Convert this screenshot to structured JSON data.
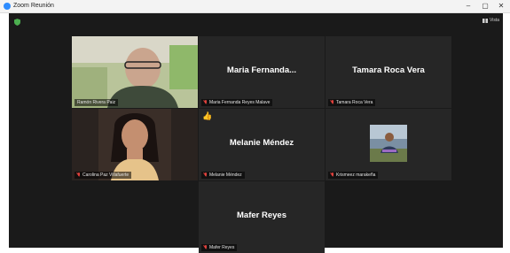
{
  "window": {
    "title": "Zoom Reunión",
    "controls": {
      "minimize": "–",
      "maximize": "▢",
      "close": "✕"
    }
  },
  "toolbar": {
    "view_label": "Vista"
  },
  "participants": [
    {
      "name": "Ramón Rivera Paiz",
      "label": "Ramón Rivera Paiz",
      "video": true,
      "active_speaker": true,
      "muted": false
    },
    {
      "name": "Maria  Fernanda...",
      "label": "Maria Fernanda Reyes Malave",
      "video": false,
      "muted": true
    },
    {
      "name": "Tamara Roca Vera",
      "label": "Tamara Roca Vera",
      "video": false,
      "muted": true
    },
    {
      "name": "Carolina Paz Villafuerte",
      "label": "Carolina Paz Villafuerte",
      "video": true,
      "muted": true
    },
    {
      "name": "Melanie Méndez",
      "label": "Melanie Méndez",
      "video": false,
      "muted": true,
      "reaction": "👍"
    },
    {
      "name": "Krismeez marakeña",
      "label": "Krismeez marakeña",
      "video": true,
      "muted": true
    },
    {
      "name": "Mafer Reyes",
      "label": "Mafer Reyes",
      "video": false,
      "muted": true
    }
  ],
  "colors": {
    "background": "#1a1a1a",
    "tile": "#262626",
    "active_border": "#7bd64e",
    "muted": "#e0413c",
    "zoom_blue": "#2d8cff"
  }
}
